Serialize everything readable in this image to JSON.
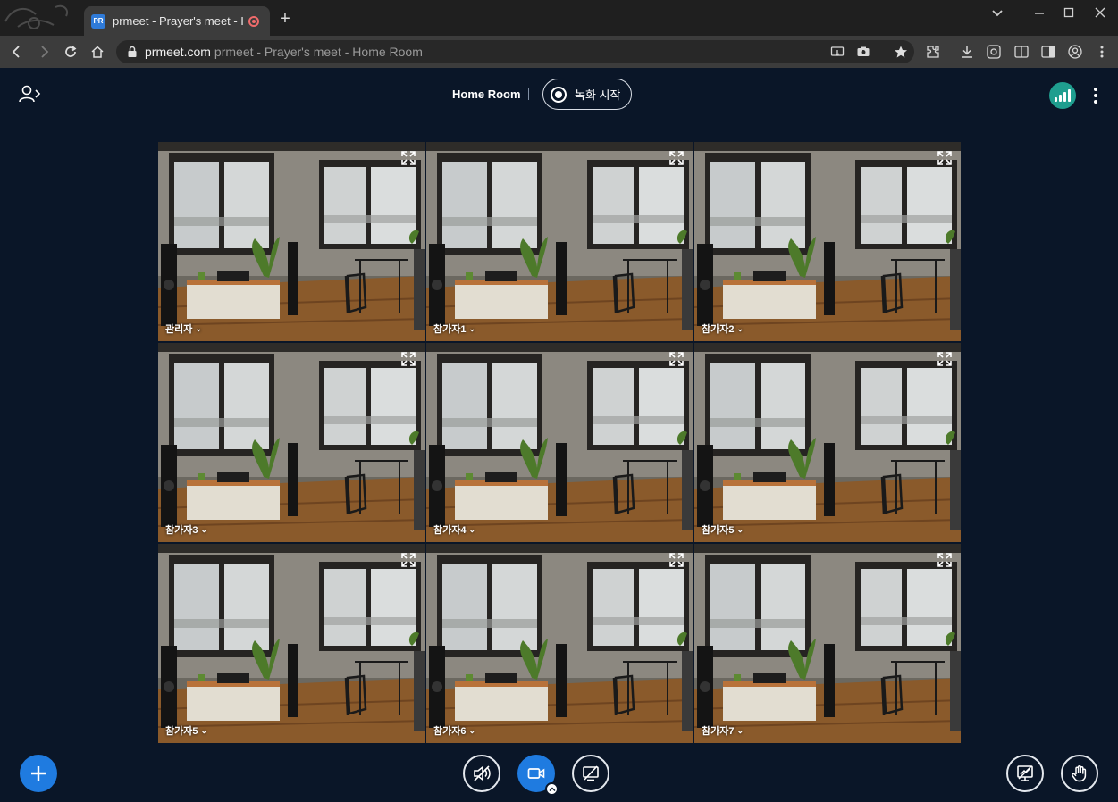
{
  "browser": {
    "tab": {
      "favicon_text": "PR",
      "title": "prmeet - Prayer's meet - Hc"
    },
    "address": {
      "host": "prmeet.com",
      "page_title": "prmeet - Prayer's meet - Home Room"
    }
  },
  "header": {
    "room_title": "Home Room",
    "record_label": "녹화 시작",
    "connection_color": "#1f9e8f"
  },
  "participants": [
    {
      "name": "관리자"
    },
    {
      "name": "참가자1"
    },
    {
      "name": "참가자2"
    },
    {
      "name": "참가자3"
    },
    {
      "name": "참가자4"
    },
    {
      "name": "참가자5"
    },
    {
      "name": "참가자5"
    },
    {
      "name": "참가자6"
    },
    {
      "name": "참가자7"
    }
  ],
  "controls": {
    "accent_color": "#1f7be0",
    "items": [
      "add",
      "speaker-mute",
      "camera",
      "screen-share-off",
      "presentation",
      "raise-hand"
    ]
  }
}
